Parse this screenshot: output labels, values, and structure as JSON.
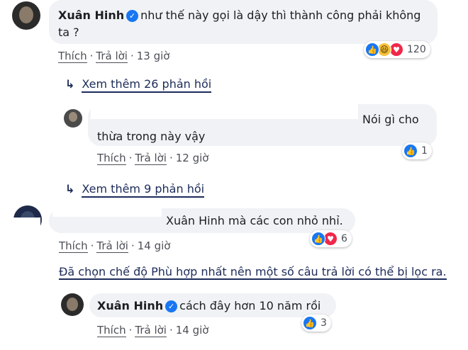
{
  "colors": {
    "bubble": "#f0f2f5",
    "like": "#1877f2",
    "love": "#f0284a",
    "haha": "#f7c33b",
    "link_dark": "#1c2b5a"
  },
  "comments": [
    {
      "author": "Xuân Hinh",
      "verified": true,
      "text_line1": "như thế này gọi là dậy thì thành công phải không",
      "text_line2": "ta ?",
      "like_label": "Thích",
      "reply_label": "Trả lời",
      "time": "13 giờ",
      "reaction_icons": [
        "like-icon",
        "haha-icon",
        "love-icon"
      ],
      "reaction_count": "120"
    },
    {
      "text_line1": "Nói gì cho",
      "text_line2": "thừa trong này vậy",
      "like_label": "Thích",
      "reply_label": "Trả lời",
      "time": "12 giờ",
      "reaction_icons": [
        "like-icon"
      ],
      "reaction_count": "1"
    },
    {
      "text_visible": "Xuân Hinh mà các con nhỏ nhỉ.",
      "like_label": "Thích",
      "reply_label": "Trả lời",
      "time": "14 giờ",
      "reaction_icons": [
        "like-icon",
        "love-icon"
      ],
      "reaction_count": "6"
    },
    {
      "author": "Xuân Hinh",
      "verified": true,
      "text": "cách đây hơn 10 năm rồi",
      "like_label": "Thích",
      "reply_label": "Trả lời",
      "time": "14 giờ",
      "reaction_icons": [
        "like-icon"
      ],
      "reaction_count": "3"
    }
  ],
  "view_more": [
    {
      "icon": "reply-arrow-icon",
      "label": "Xem thêm 26 phản hồi"
    },
    {
      "icon": "reply-arrow-icon",
      "label": "Xem thêm 9 phản hồi"
    }
  ],
  "filter_note": "Đã chọn chế độ Phù hợp nhất nên một số câu trả lời có thể bị lọc ra."
}
